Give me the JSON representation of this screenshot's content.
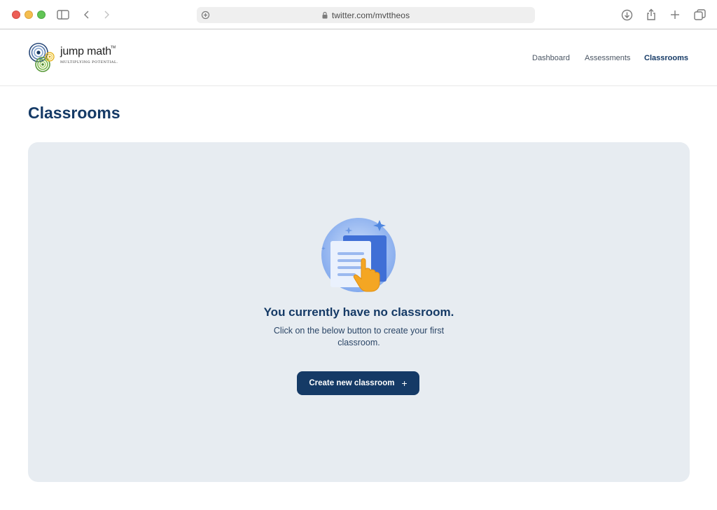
{
  "browser": {
    "url": "twitter.com/mvttheos"
  },
  "site": {
    "logo_word": "jump math",
    "logo_tm": "TM",
    "logo_tagline": "MULTIPLYING POTENTIAL.",
    "nav": [
      {
        "label": "Dashboard",
        "active": false
      },
      {
        "label": "Assessments",
        "active": false
      },
      {
        "label": "Classrooms",
        "active": true
      }
    ]
  },
  "main": {
    "title": "Classrooms",
    "empty_state": {
      "icon": "document-pointer-illustration",
      "heading": "You currently have no classroom.",
      "description": "Click on the below button to create your first classroom.",
      "button_label": "Create new classroom",
      "button_icon": "+"
    }
  },
  "colors": {
    "brand_navy": "#153a66",
    "card_bg": "#e7ecf1",
    "accent_orange": "#f4a623"
  }
}
